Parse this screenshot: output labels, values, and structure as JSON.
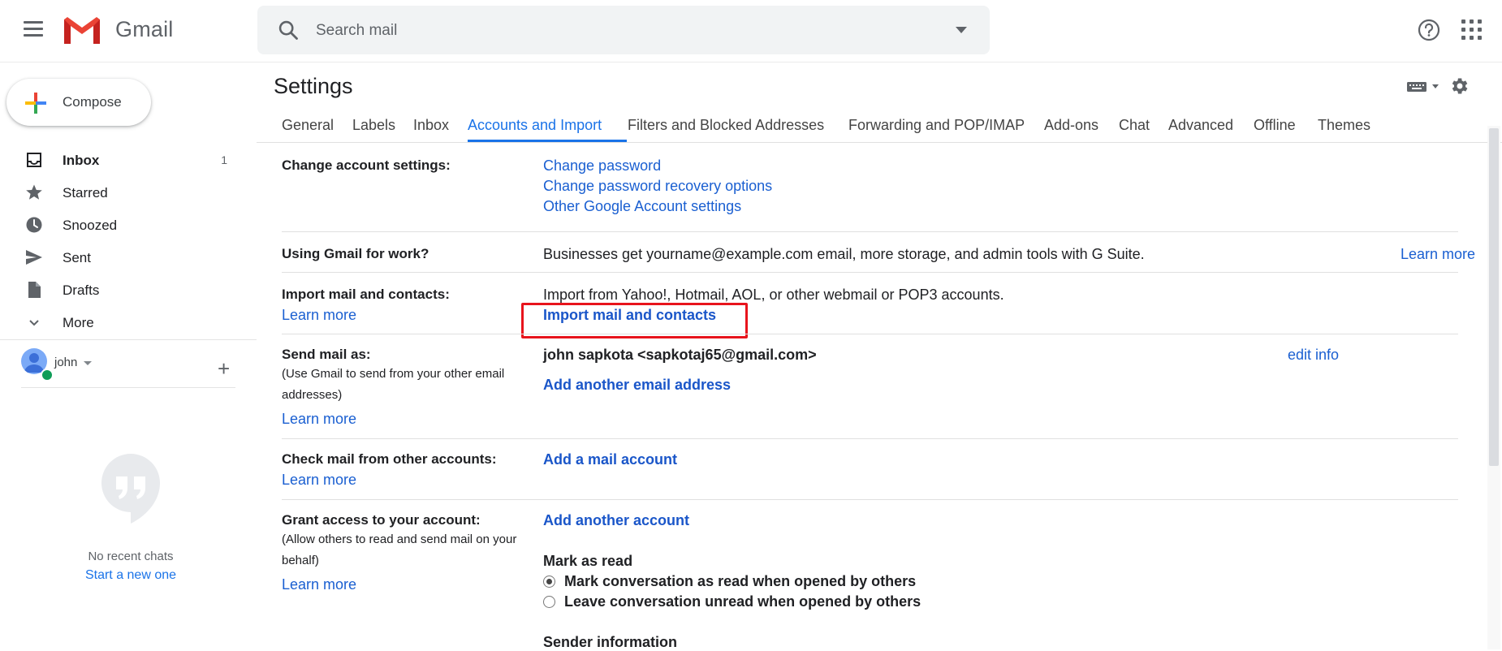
{
  "app": {
    "logo_text": "Gmail"
  },
  "search": {
    "placeholder": "Search mail"
  },
  "compose": {
    "label": "Compose"
  },
  "nav": [
    {
      "label": "Inbox",
      "count": "1",
      "icon": "inbox-icon"
    },
    {
      "label": "Starred",
      "count": "",
      "icon": "star-icon"
    },
    {
      "label": "Snoozed",
      "count": "",
      "icon": "clock-icon"
    },
    {
      "label": "Sent",
      "count": "",
      "icon": "send-icon"
    },
    {
      "label": "Drafts",
      "count": "",
      "icon": "draft-icon"
    },
    {
      "label": "More",
      "count": "",
      "icon": "chevron-down-icon"
    }
  ],
  "user": {
    "name": "john"
  },
  "chat": {
    "empty_text": "No recent chats",
    "start_link": "Start a new one"
  },
  "page": {
    "title": "Settings"
  },
  "tabs": [
    "General",
    "Labels",
    "Inbox",
    "Accounts and Import",
    "Filters and Blocked Addresses",
    "Forwarding and POP/IMAP",
    "Add-ons",
    "Chat",
    "Advanced",
    "Offline",
    "Themes"
  ],
  "active_tab": "Accounts and Import",
  "sections": {
    "change_account": {
      "label": "Change account settings:",
      "links": [
        "Change password",
        "Change password recovery options",
        "Other Google Account settings"
      ]
    },
    "gmail_work": {
      "label": "Using Gmail for work?",
      "text": "Businesses get yourname@example.com email, more storage, and admin tools with G Suite.",
      "link": "Learn more"
    },
    "import": {
      "label": "Import mail and contacts:",
      "learn_more": "Learn more",
      "text": "Import from Yahoo!, Hotmail, AOL, or other webmail or POP3 accounts.",
      "action": "Import mail and contacts"
    },
    "send_as": {
      "label": "Send mail as:",
      "sub": "(Use Gmail to send from your other email addresses)",
      "learn_more": "Learn more",
      "address": "john sapkota <sapkotaj65@gmail.com>",
      "edit": "edit info",
      "add": "Add another email address"
    },
    "check_mail": {
      "label": "Check mail from other accounts:",
      "learn_more": "Learn more",
      "add": "Add a mail account"
    },
    "grant": {
      "label": "Grant access to your account:",
      "sub": "(Allow others to read and send mail on your behalf)",
      "learn_more": "Learn more",
      "add": "Add another account",
      "mark_as_read_heading": "Mark as read",
      "option_read": "Mark conversation as read when opened by others",
      "option_unread": "Leave conversation unread when opened by others",
      "sender_info_heading": "Sender information"
    }
  },
  "colors": {
    "accent": "#1a73e8",
    "link": "#1a5fd1",
    "highlight_box": "#e8141c"
  }
}
